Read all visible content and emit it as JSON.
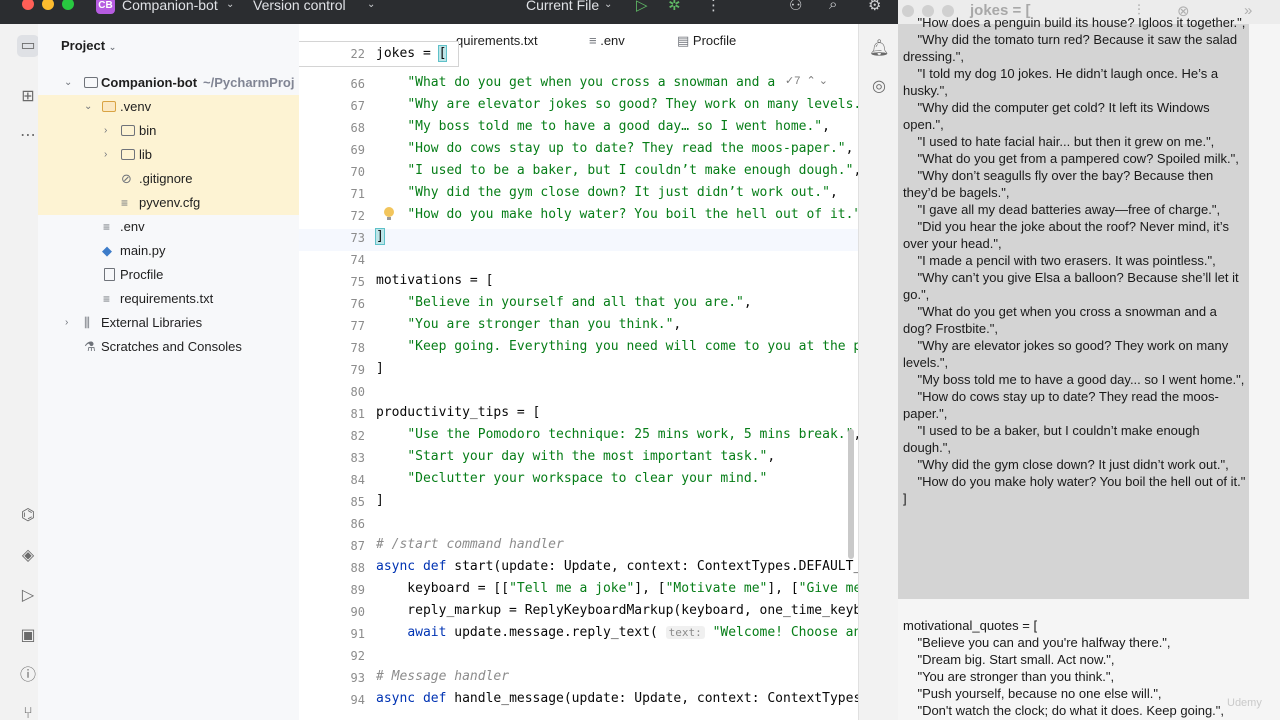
{
  "titlebar": {
    "project_badge": "CB",
    "project_name": "Companion-bot",
    "version_control": "Version control",
    "run_config": "Current File"
  },
  "project_panel": {
    "header": "Project",
    "tree": [
      {
        "label": "Companion-bot",
        "path": "~/PycharmProj"
      },
      {
        "label": ".venv"
      },
      {
        "label": "bin"
      },
      {
        "label": "lib"
      },
      {
        "label": ".gitignore"
      },
      {
        "label": "pyvenv.cfg"
      },
      {
        "label": ".env"
      },
      {
        "label": "main.py"
      },
      {
        "label": "Procfile"
      },
      {
        "label": "requirements.txt"
      },
      {
        "label": "External Libraries"
      },
      {
        "label": "Scratches and Consoles"
      }
    ]
  },
  "editor": {
    "tabs": [
      "quirements.txt",
      ".env",
      "Procfile"
    ],
    "sticky_line": {
      "number": "22",
      "text": "jokes = ["
    },
    "fold_hint": "7",
    "lines": [
      {
        "n": "66",
        "text": "    \"What do you get when you cross a snowman and a "
      },
      {
        "n": "67",
        "text": "    \"Why are elevator jokes so good? They work on many levels."
      },
      {
        "n": "68",
        "text": "    \"My boss told me to have a good day… so I went home.\","
      },
      {
        "n": "69",
        "text": "    \"How do cows stay up to date? They read the moos-paper.\","
      },
      {
        "n": "70",
        "text": "    \"I used to be a baker, but I couldn’t make enough dough.\","
      },
      {
        "n": "71",
        "text": "    \"Why did the gym close down? It just didn’t work out.\","
      },
      {
        "n": "72",
        "text": "    \"How do you make holy water? You boil the hell out of it.\""
      },
      {
        "n": "73",
        "text": "]"
      },
      {
        "n": "74",
        "text": ""
      },
      {
        "n": "75",
        "text": "motivations = ["
      },
      {
        "n": "76",
        "text": "    \"Believe in yourself and all that you are.\","
      },
      {
        "n": "77",
        "text": "    \"You are stronger than you think.\","
      },
      {
        "n": "78",
        "text": "    \"Keep going. Everything you need will come to you at the p"
      },
      {
        "n": "79",
        "text": "]"
      },
      {
        "n": "80",
        "text": ""
      },
      {
        "n": "81",
        "text": "productivity_tips = ["
      },
      {
        "n": "82",
        "text": "    \"Use the Pomodoro technique: 25 mins work, 5 mins break.\","
      },
      {
        "n": "83",
        "text": "    \"Start your day with the most important task.\","
      },
      {
        "n": "84",
        "text": "    \"Declutter your workspace to clear your mind.\""
      },
      {
        "n": "85",
        "text": "]"
      },
      {
        "n": "86",
        "text": ""
      },
      {
        "n": "87",
        "text": "# /start command handler"
      },
      {
        "n": "88",
        "text": "async def start(update: Update, context: ContextTypes.DEFAULT_"
      },
      {
        "n": "89",
        "text": "    keyboard = [[\"Tell me a joke\"], [\"Motivate me\"], [\"Give me"
      },
      {
        "n": "90",
        "text": "    reply_markup = ReplyKeyboardMarkup(keyboard, one_time_keyb"
      },
      {
        "n": "91",
        "text": "    await update.message.reply_text( text: \"Welcome! Choose an c"
      },
      {
        "n": "92",
        "text": ""
      },
      {
        "n": "93",
        "text": "# Message handler"
      },
      {
        "n": "94",
        "text": "async def handle_message(update: Update, context: ContextTypes"
      }
    ]
  },
  "notes": {
    "title": "jokes = [",
    "selected_text": "    \"How does a penguin build its house? Igloos it together.\",\n    \"Why did the tomato turn red? Because it saw the salad dressing.\",\n    \"I told my dog 10 jokes. He didn’t laugh once. He’s a husky.\",\n    \"Why did the computer get cold? It left its Windows open.\",\n    \"I used to hate facial hair... but then it grew on me.\",\n    \"What do you get from a pampered cow? Spoiled milk.\",\n    \"Why don’t seagulls fly over the bay? Because then they’d be bagels.\",\n    \"I gave all my dead batteries away—free of charge.\",\n    \"Did you hear the joke about the roof? Never mind, it’s over your head.\",\n    \"I made a pencil with two erasers. It was pointless.\",\n    \"Why can’t you give Elsa a balloon? Because she’ll let it go.\",\n    \"What do you get when you cross a snowman and a dog? Frostbite.\",\n    \"Why are elevator jokes so good? They work on many levels.\",\n    \"My boss told me to have a good day... so I went home.\",\n    \"How do cows stay up to date? They read the moos-paper.\",\n    \"I used to be a baker, but I couldn’t make enough dough.\",\n    \"Why did the gym close down? It just didn’t work out.\",\n    \"How do you make holy water? You boil the hell out of it.\"\n]",
    "rest_text": "motivational_quotes = [\n    \"Believe you can and you're halfway there.\",\n    \"Dream big. Start small. Act now.\",\n    \"You are stronger than you think.\",\n    \"Push yourself, because no one else will.\",\n    \"Don't watch the clock; do what it does. Keep going.\","
  },
  "watermark": "Udemy"
}
